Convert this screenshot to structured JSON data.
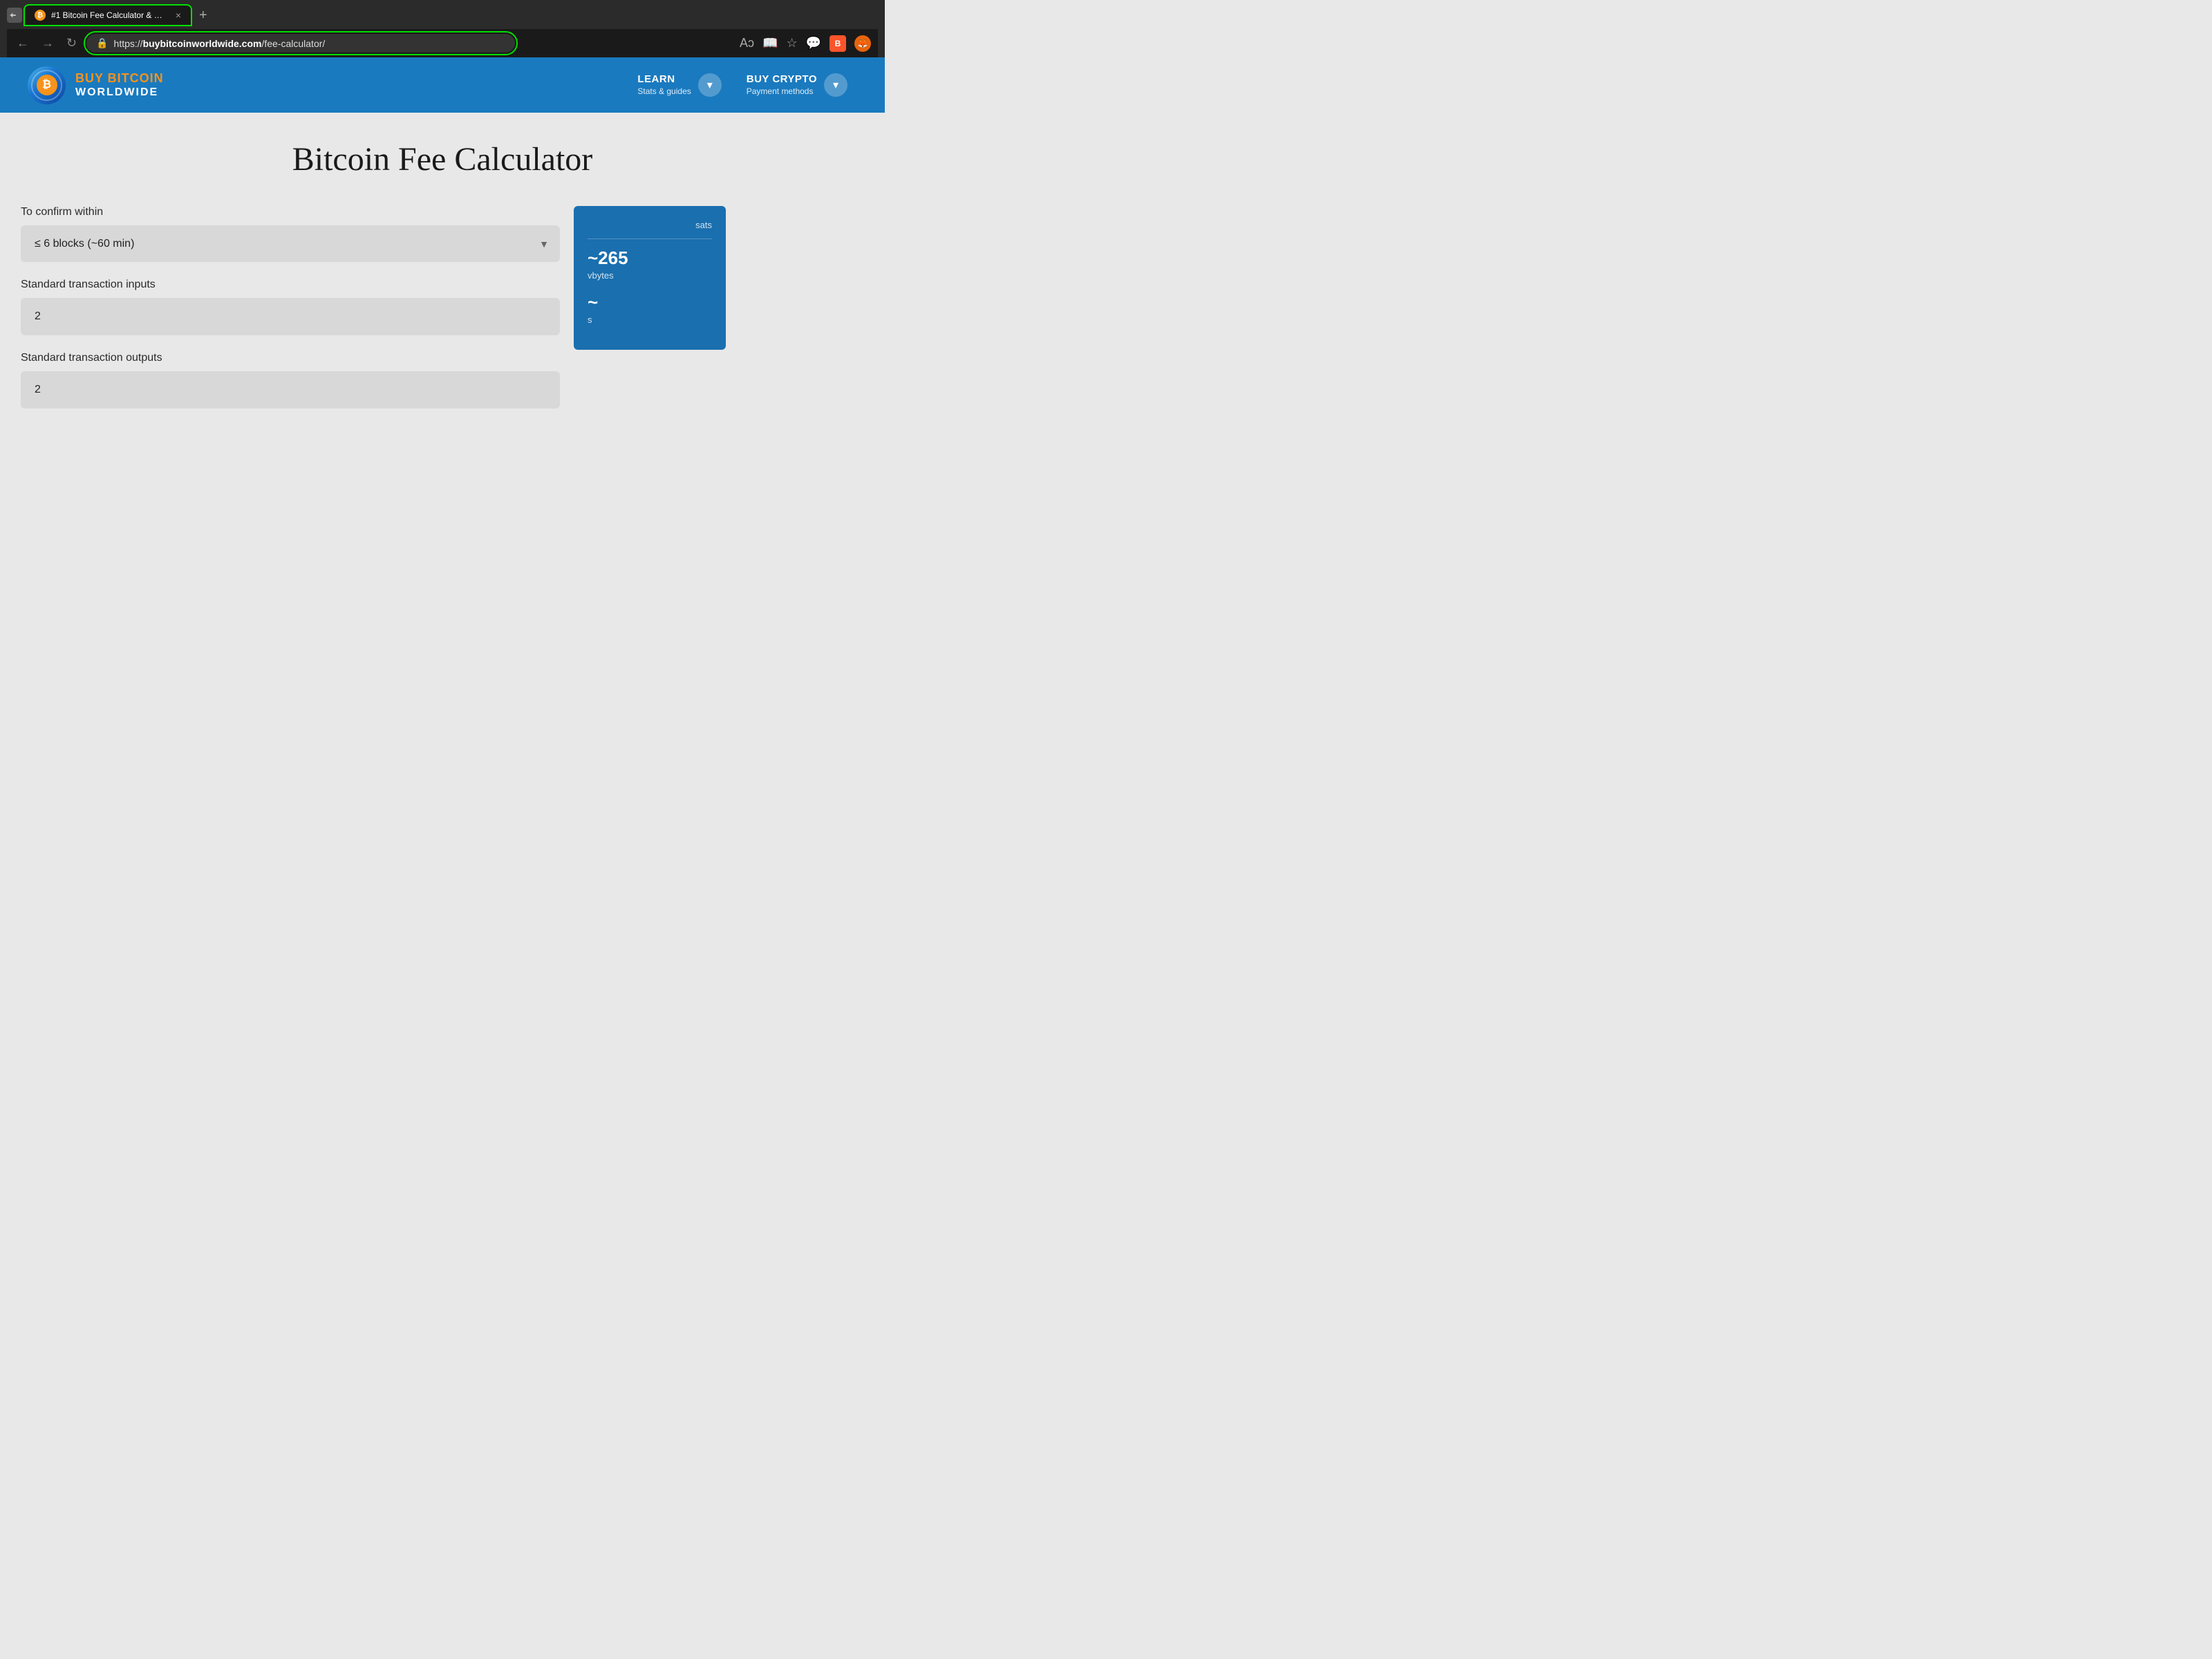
{
  "browser": {
    "tab": {
      "title": "#1 Bitcoin Fee Calculator & Estin",
      "favicon": "₿",
      "close_label": "×",
      "new_tab_label": "+"
    },
    "address_bar": {
      "protocol": "https://",
      "domain": "buybitcoinworldwide.com",
      "path": "/fee-calculator/"
    },
    "back_label": "←",
    "forward_label": "→",
    "refresh_label": "↻"
  },
  "nav": {
    "logo": {
      "line1": "BUY BITCOIN",
      "line2": "WORLDWIDE",
      "btc_symbol": "₿"
    },
    "learn": {
      "title": "LEARN",
      "subtitle": "Stats & guides"
    },
    "buy_crypto": {
      "title": "BUY CRYPTO",
      "subtitle": "Payment methods"
    }
  },
  "page": {
    "title": "Bitcoin Fee Calculator",
    "fields": {
      "confirm_within": {
        "label": "To confirm within",
        "value": "≤ 6 blocks (~60 min)"
      },
      "tx_inputs": {
        "label": "Standard transaction inputs",
        "value": "2"
      },
      "tx_outputs": {
        "label": "Standard transaction outputs",
        "value": "2"
      }
    },
    "results": {
      "unit_label": "sats",
      "vbytes_value": "~265",
      "vbytes_label": "vbytes",
      "second_value": "~",
      "second_label": "s"
    }
  }
}
